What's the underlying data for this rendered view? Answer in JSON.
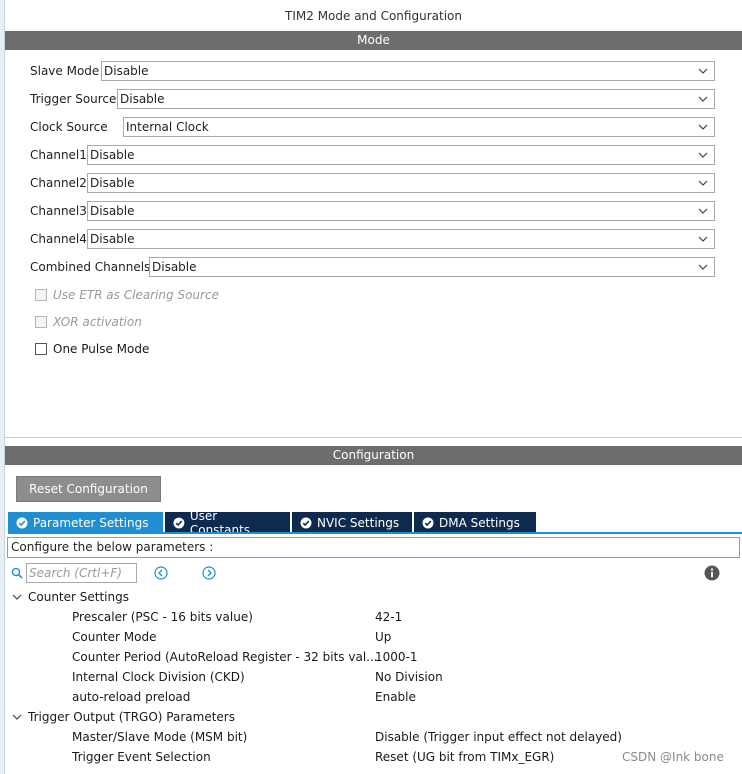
{
  "window": {
    "title": "TIM2 Mode and Configuration"
  },
  "mode": {
    "header": "Mode",
    "fields": [
      {
        "label": "Slave Mode",
        "value": "Disable"
      },
      {
        "label": "Trigger Source",
        "value": "Disable"
      },
      {
        "label": "Clock Source",
        "value": "Internal Clock"
      },
      {
        "label": "Channel1",
        "value": "Disable"
      },
      {
        "label": "Channel2",
        "value": "Disable"
      },
      {
        "label": "Channel3",
        "value": "Disable"
      },
      {
        "label": "Channel4",
        "value": "Disable"
      },
      {
        "label": "Combined Channels",
        "value": "Disable"
      }
    ],
    "checkboxes": [
      {
        "label": "Use ETR as Clearing Source",
        "checked": false,
        "enabled": false
      },
      {
        "label": "XOR activation",
        "checked": false,
        "enabled": false
      },
      {
        "label": "One Pulse Mode",
        "checked": false,
        "enabled": true
      }
    ]
  },
  "configuration": {
    "header": "Configuration",
    "reset_label": "Reset Configuration",
    "tabs": [
      {
        "label": "Parameter Settings",
        "active": true,
        "icon": "check-circle-icon"
      },
      {
        "label": "User Constants",
        "active": false,
        "icon": "check-circle-icon"
      },
      {
        "label": "NVIC Settings",
        "active": false,
        "icon": "check-circle-icon"
      },
      {
        "label": "DMA Settings",
        "active": false,
        "icon": "check-circle-icon"
      }
    ],
    "hint": "Configure the below parameters :",
    "search": {
      "placeholder": "Search (Crtl+F)"
    },
    "groups": [
      {
        "title": "Counter Settings",
        "params": [
          {
            "name": "Prescaler (PSC - 16 bits value)",
            "value": "42-1"
          },
          {
            "name": "Counter Mode",
            "value": "Up"
          },
          {
            "name": "Counter Period (AutoReload Register - 32 bits val...",
            "value": "1000-1"
          },
          {
            "name": "Internal Clock Division (CKD)",
            "value": "No Division"
          },
          {
            "name": "auto-reload preload",
            "value": "Enable"
          }
        ]
      },
      {
        "title": "Trigger Output (TRGO) Parameters",
        "params": [
          {
            "name": "Master/Slave Mode (MSM bit)",
            "value": "Disable (Trigger input effect not delayed)"
          },
          {
            "name": "Trigger Event Selection",
            "value": "Reset (UG bit from TIMx_EGR)"
          }
        ]
      }
    ]
  },
  "watermark": "CSDN @Ink bone",
  "colors": {
    "section_header": "#6d6d6d",
    "tab_active": "#1f8fd1",
    "tab_inactive": "#0e2b4f",
    "nav_arrow": "#1f8fd1"
  }
}
